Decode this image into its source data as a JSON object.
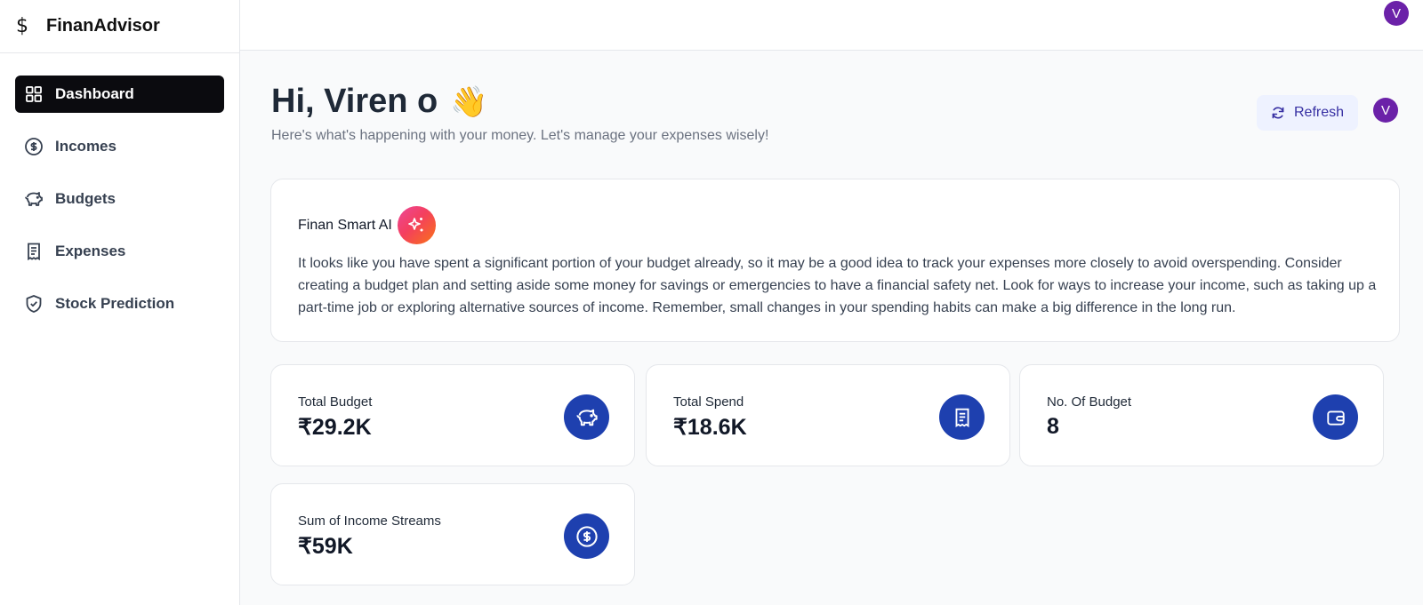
{
  "app": {
    "name": "FinanAdvisor",
    "logo_icon": "dollar-icon"
  },
  "sidebar": {
    "items": [
      {
        "label": "Dashboard",
        "icon": "grid-icon",
        "active": true
      },
      {
        "label": "Incomes",
        "icon": "circle-dollar-icon"
      },
      {
        "label": "Budgets",
        "icon": "piggy-bank-icon"
      },
      {
        "label": "Expenses",
        "icon": "receipt-icon"
      },
      {
        "label": "Stock Prediction",
        "icon": "shield-check-icon"
      }
    ]
  },
  "user": {
    "initial": "V"
  },
  "header": {
    "greeting": "Hi, Viren o",
    "wave_emoji": "👋",
    "subtitle": "Here's what's happening with your money. Let's manage your expenses wisely!",
    "refresh_label": "Refresh"
  },
  "ai": {
    "title": "Finan Smart AI",
    "icon": "sparkles-icon",
    "text": "It looks like you have spent a significant portion of your budget already, so it may be a good idea to track your expenses more closely to avoid overspending. Consider creating a budget plan and setting aside some money for savings or emergencies to have a financial safety net. Look for ways to increase your income, such as taking up a part-time job or exploring alternative sources of income. Remember, small changes in your spending habits can make a big difference in the long run."
  },
  "stats": [
    {
      "label": "Total Budget",
      "value": "₹29.2K",
      "icon": "piggy-bank-icon"
    },
    {
      "label": "Total Spend",
      "value": "₹18.6K",
      "icon": "receipt-icon"
    },
    {
      "label": "No. Of Budget",
      "value": "8",
      "icon": "wallet-icon"
    },
    {
      "label": "Sum of Income Streams",
      "value": "₹59K",
      "icon": "circle-dollar-icon"
    }
  ],
  "colors": {
    "accent": "#1e40af",
    "avatar": "#6b21a8",
    "active_nav": "#0b0b0f"
  }
}
